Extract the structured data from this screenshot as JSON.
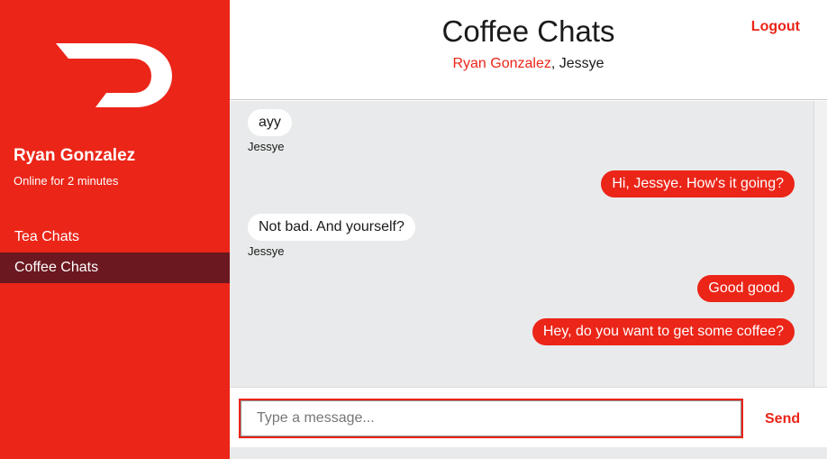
{
  "sidebar": {
    "logo_icon": "doordash-logo-icon",
    "user_name": "Ryan Gonzalez",
    "user_status": "Online for 2 minutes",
    "items": [
      {
        "label": "Tea Chats",
        "active": false
      },
      {
        "label": "Coffee Chats",
        "active": true
      }
    ]
  },
  "header": {
    "title": "Coffee Chats",
    "participant_1": "Ryan Gonzalez",
    "separator": ", ",
    "participant_2": "Jessye",
    "logout_label": "Logout"
  },
  "messages": [
    {
      "text": "ayy",
      "direction": "in",
      "sender": "Jessye"
    },
    {
      "text": "Hi, Jessye. How's it going?",
      "direction": "out"
    },
    {
      "text": "Not bad. And yourself?",
      "direction": "in",
      "sender": "Jessye"
    },
    {
      "text": "Good good.",
      "direction": "out"
    },
    {
      "text": "Hey, do you want to get some coffee?",
      "direction": "out"
    }
  ],
  "composer": {
    "placeholder": "Type a message...",
    "value": "",
    "send_label": "Send"
  },
  "colors": {
    "accent": "#eb2518",
    "active_nav": "#6b1820",
    "chat_bg": "#e9eaeb"
  }
}
